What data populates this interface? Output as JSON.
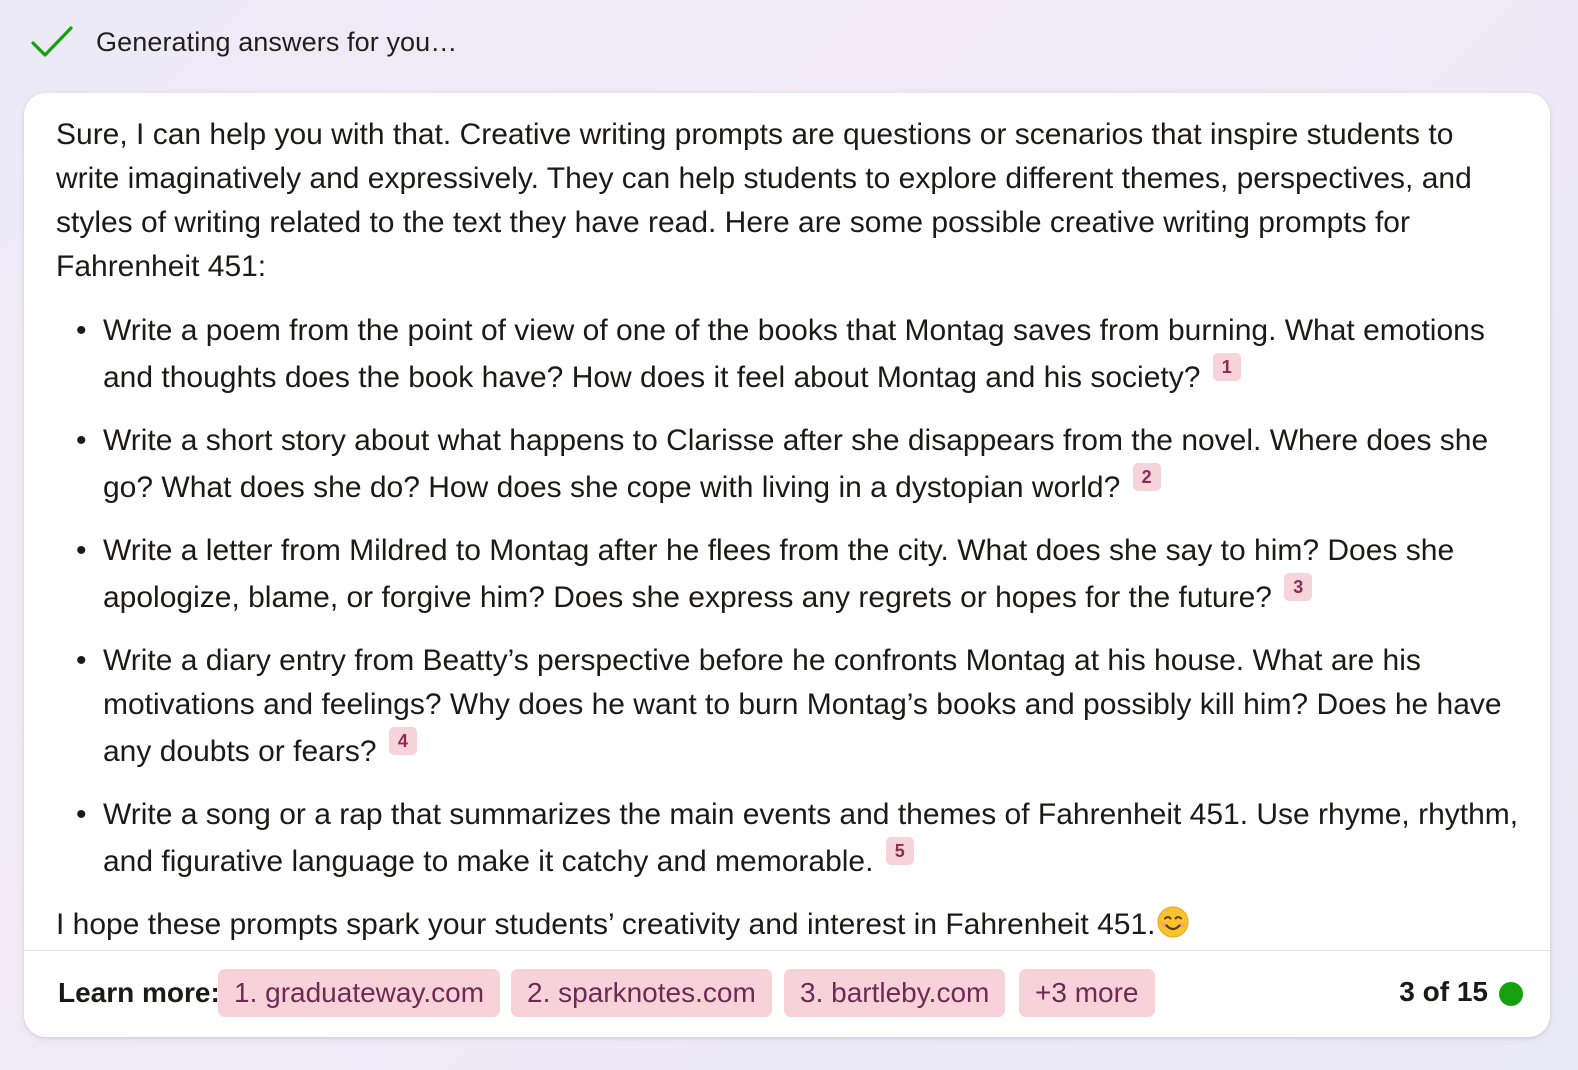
{
  "status": {
    "icon": "checkmark-icon",
    "text": "Generating answers for you…",
    "icon_color": "#13a10e"
  },
  "response": {
    "intro": "Sure, I can help you with that. Creative writing prompts are questions or scenarios that inspire students to write imaginatively and expressively. They can help students to explore different themes, perspectives, and styles of writing related to the text they have read. Here are some possible creative writing prompts for Fahrenheit 451:",
    "prompts": [
      {
        "text": "Write a poem from the point of view of one of the books that Montag saves from burning. What emotions and thoughts does the book have? How does it feel about Montag and his society?",
        "citation": "1"
      },
      {
        "text": "Write a short story about what happens to Clarisse after she disappears from the novel. Where does she go? What does she do? How does she cope with living in a dystopian world?",
        "citation": "2"
      },
      {
        "text": "Write a letter from Mildred to Montag after he flees from the city. What does she say to him? Does she apologize, blame, or forgive him? Does she express any regrets or hopes for the future?",
        "citation": "3"
      },
      {
        "text": "Write a diary entry from Beatty’s perspective before he confronts Montag at his house. What are his motivations and feelings? Why does he want to burn Montag’s books and possibly kill him? Does he have any doubts or fears?",
        "citation": "4"
      },
      {
        "text": "Write a song or a rap that summarizes the main events and themes of Fahrenheit 451. Use rhyme, rhythm, and figurative language to make it catchy and memorable.",
        "citation": "5"
      }
    ],
    "bullet": "•",
    "outro": "I hope these prompts spark your students’ creativity and interest in Fahrenheit 451.",
    "outro_icon": "smiling-face-emoji-icon"
  },
  "footer": {
    "learn_more_label": "Learn more:",
    "sources": [
      {
        "label": "1. graduateway.com"
      },
      {
        "label": "2. sparknotes.com"
      },
      {
        "label": "3. bartleby.com"
      },
      {
        "label": "+3 more"
      }
    ],
    "page_count": "3 of 15",
    "status_dot_color": "#13a10e",
    "chip_color": "#f8d2d9"
  }
}
